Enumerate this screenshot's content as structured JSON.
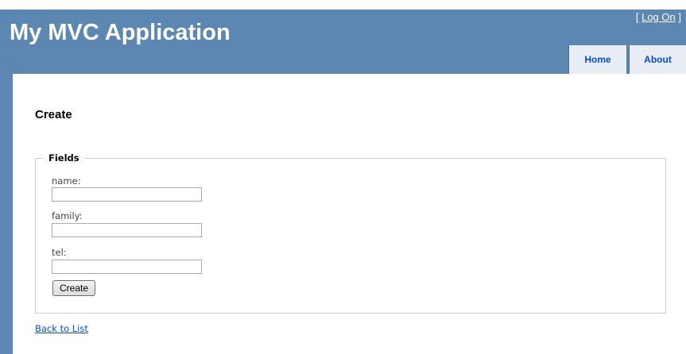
{
  "header": {
    "app_title": "My MVC Application",
    "login": {
      "open_bracket": "[",
      "link_label": "Log On",
      "close_bracket": "]"
    },
    "menu": [
      {
        "label": "Home"
      },
      {
        "label": "About"
      }
    ]
  },
  "main": {
    "heading": "Create",
    "form": {
      "legend": "Fields",
      "fields": [
        {
          "label": "name:",
          "value": ""
        },
        {
          "label": "family:",
          "value": ""
        },
        {
          "label": "tel:",
          "value": ""
        }
      ],
      "submit_label": "Create"
    },
    "back_link": "Back to List"
  },
  "colors": {
    "header_bg": "#5c87b2",
    "tab_bg": "#e8eef4",
    "link": "#034af3",
    "border": "#cccccc"
  }
}
